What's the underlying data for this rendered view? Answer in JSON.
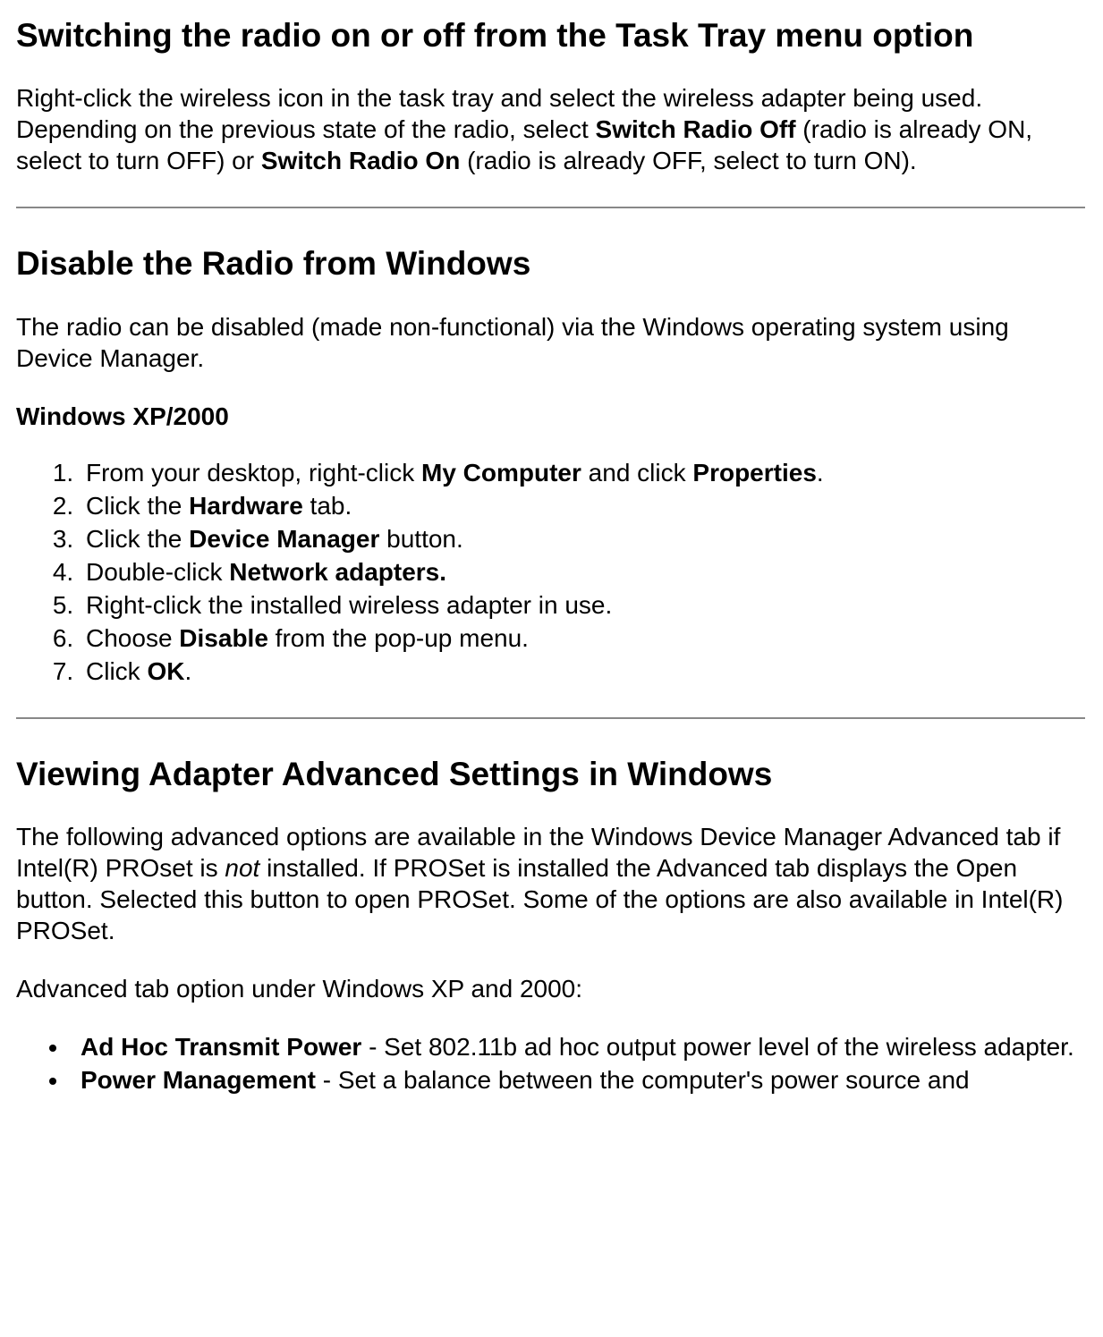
{
  "section1": {
    "heading": "Switching the radio on or off from the Task Tray menu option",
    "para_pre": "Right-click the wireless icon in the task tray and select the wireless adapter being used. Depending on the previous state of the radio, select ",
    "bold1": "Switch Radio Off",
    "mid1": " (radio is already ON, select to turn OFF) or ",
    "bold2": "Switch Radio On",
    "tail": " (radio is already OFF, select to turn ON)."
  },
  "section2": {
    "heading": "Disable the Radio from Windows",
    "para": "The radio can be disabled (made non-functional) via the Windows operating system using Device Manager.",
    "subheading": "Windows XP/2000",
    "steps": [
      {
        "pre": "From your desktop, right-click ",
        "b1": "My Computer",
        "mid": " and click ",
        "b2": "Properties",
        "post": "."
      },
      {
        "pre": "Click the ",
        "b1": "Hardware",
        "post": " tab."
      },
      {
        "pre": "Click the ",
        "b1": "Device Manager",
        "post": " button."
      },
      {
        "pre": "Double-click ",
        "b1": "Network adapters.",
        "post": ""
      },
      {
        "pre": "Right-click the installed wireless adapter in use.",
        "b1": "",
        "post": ""
      },
      {
        "pre": "Choose ",
        "b1": "Disable",
        "post": " from the pop-up menu."
      },
      {
        "pre": "Click ",
        "b1": "OK",
        "post": "."
      }
    ]
  },
  "section3": {
    "heading": "Viewing Adapter Advanced Settings in Windows",
    "para_pre": "The following advanced options are available in the Windows Device Manager Advanced tab if Intel(R) PROset is ",
    "italic": "not",
    "para_post": " installed. If PROSet is installed the Advanced tab displays the Open button. Selected this button to open PROSet. Some of the options are also available in Intel(R) PROSet.",
    "para2": "Advanced tab option under Windows XP and 2000:",
    "bullets": [
      {
        "b": "Ad Hoc Transmit Power",
        "t": " - Set 802.11b ad hoc output power level of the wireless adapter."
      },
      {
        "b": "Power Management",
        "t": " - Set a balance between the computer's power source and"
      }
    ]
  }
}
